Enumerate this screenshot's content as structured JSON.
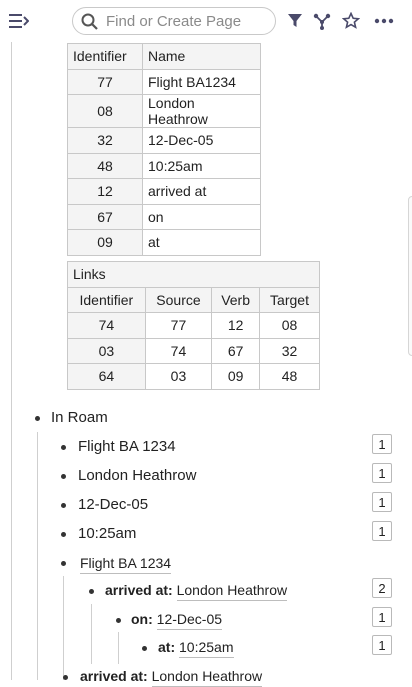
{
  "search": {
    "placeholder": "Find or Create Page"
  },
  "icons": {
    "menu": "menu-toggle-icon",
    "search": "search-icon",
    "filter": "filter-icon",
    "graph": "graph-icon",
    "star": "star-icon",
    "more": "more-icon"
  },
  "table1": {
    "headers": [
      "Identifier",
      "Name"
    ],
    "rows": [
      [
        "77",
        "Flight BA1234"
      ],
      [
        "08",
        "London Heathrow"
      ],
      [
        "32",
        "12-Dec-05"
      ],
      [
        "48",
        "10:25am"
      ],
      [
        "12",
        "arrived at"
      ],
      [
        "67",
        "on"
      ],
      [
        "09",
        "at"
      ]
    ]
  },
  "table2": {
    "title": "Links",
    "headers": [
      "Identifier",
      "Source",
      "Verb",
      "Target"
    ],
    "rows": [
      [
        "74",
        "77",
        "12",
        "08"
      ],
      [
        "03",
        "74",
        "67",
        "32"
      ],
      [
        "64",
        "03",
        "09",
        "48"
      ]
    ]
  },
  "outline": {
    "root": "In Roam",
    "items": [
      {
        "text": "Flight BA 1234",
        "count": "1"
      },
      {
        "text": "London Heathrow",
        "count": "1"
      },
      {
        "text": "12-Dec-05",
        "count": "1"
      },
      {
        "text": "10:25am",
        "count": "1"
      }
    ],
    "flight_ref": "Flight BA 1234",
    "arrived_label": "arrived at:",
    "arrived_value": "London Heathrow",
    "arrived_count": "2",
    "on_label": "on:",
    "on_value": "12-Dec-05",
    "on_count": "1",
    "at_label": "at:",
    "at_value": "10:25am",
    "at_count": "1",
    "bottom_label": "arrived at:",
    "bottom_value": "London Heathrow"
  }
}
